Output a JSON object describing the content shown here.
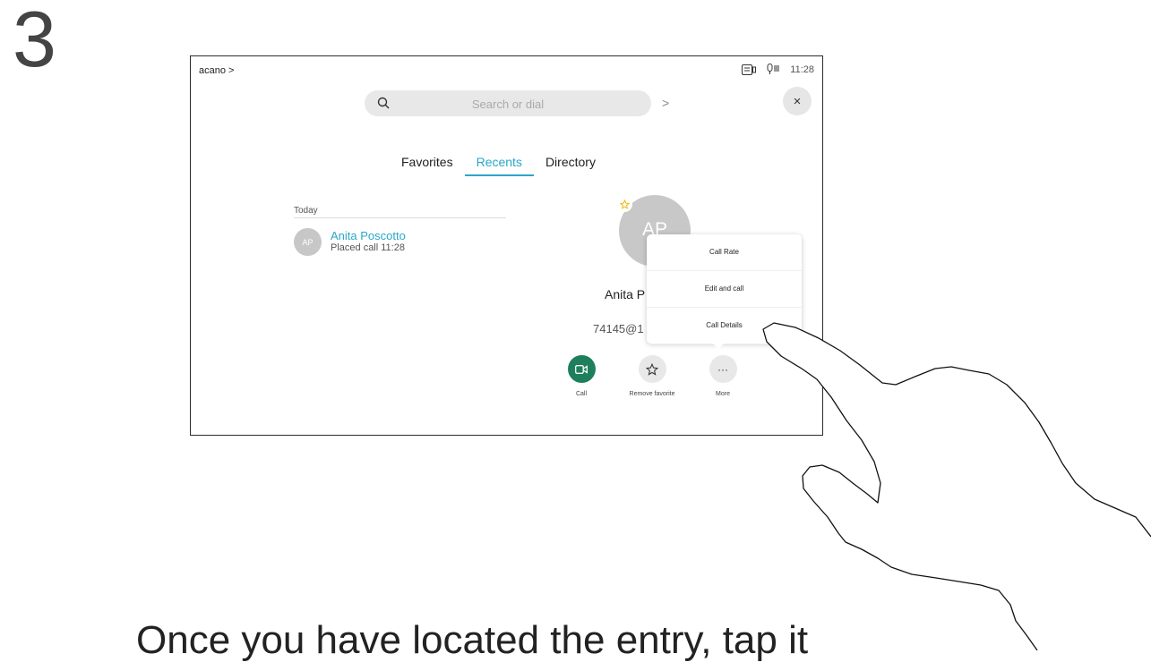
{
  "step": {
    "number": "3"
  },
  "caption": "Once you have located the entry, tap it",
  "screen": {
    "brand": "acano >",
    "status": {
      "time": "11:28"
    },
    "search": {
      "placeholder": "Search or dial",
      "arrow": ">"
    },
    "close_label": "×",
    "tabs": [
      {
        "label": "Favorites",
        "active": false
      },
      {
        "label": "Recents",
        "active": true
      },
      {
        "label": "Directory",
        "active": false
      }
    ],
    "section_label": "Today",
    "recent": {
      "initials": "AP",
      "name": "Anita Poscotto",
      "detail": "Placed call 11:28"
    },
    "contact": {
      "initials": "AP",
      "name": "Anita P",
      "number": "74145@1"
    },
    "menu": {
      "items": [
        "Call Rate",
        "Edit and call",
        "Call Details"
      ]
    },
    "actions": {
      "call": {
        "label": "Call",
        "color": "#1e7f5c"
      },
      "remove_favorite": {
        "label": "Remove favorite"
      },
      "more": {
        "label": "More",
        "glyph": "···"
      }
    },
    "colors": {
      "accent": "#2aa7c8",
      "star": "#f0b400"
    }
  }
}
